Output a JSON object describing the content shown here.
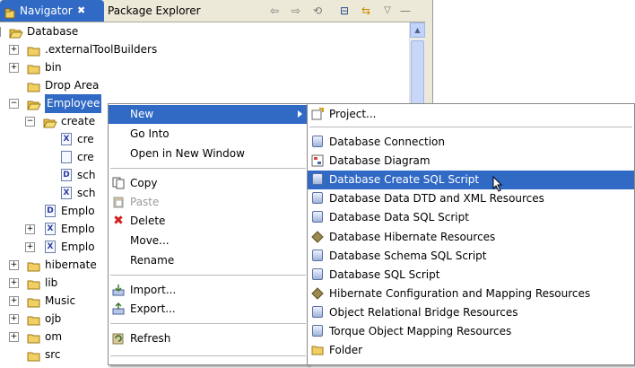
{
  "tabs": {
    "navigator": "Navigator",
    "navigator_close": "✖",
    "package_explorer": "Package Explorer"
  },
  "toolbar": {
    "back": "⇦",
    "forward": "⇨",
    "refresh": "⟲",
    "collapse": "⊟",
    "link": "⇆",
    "menu": "▽",
    "minimize": "—"
  },
  "tree": {
    "root": "Database",
    "items": [
      ".externalToolBuilders",
      "bin",
      "Drop Area",
      "Employee",
      "create",
      "cre",
      "cre",
      "sch",
      "sch",
      "Emplo",
      "Emplo",
      "Emplo",
      "hibernate",
      "lib",
      "Music",
      "ojb",
      "om",
      "src"
    ],
    "file_glyphs": [
      "X",
      "",
      "D",
      "X",
      "D",
      "X",
      "X"
    ],
    "expander_plus": "+",
    "expander_minus": "−"
  },
  "context_menu": {
    "items": [
      "New",
      "Go Into",
      "Open in New Window",
      "Copy",
      "Paste",
      "Delete",
      "Move...",
      "Rename",
      "Import...",
      "Export...",
      "Refresh"
    ]
  },
  "new_submenu": {
    "items": [
      "Project...",
      "Database Connection",
      "Database Diagram",
      "Database Create SQL Script",
      "Database Data DTD and XML Resources",
      "Database Data SQL Script",
      "Database Hibernate Resources",
      "Database Schema SQL Script",
      "Database SQL Script",
      "Hibernate Configuration and Mapping Resources",
      "Object Relational Bridge Resources",
      "Torque Object Mapping Resources",
      "Folder"
    ]
  },
  "colors": {
    "selection": "#316ac5",
    "folder": "#e8c14a"
  }
}
